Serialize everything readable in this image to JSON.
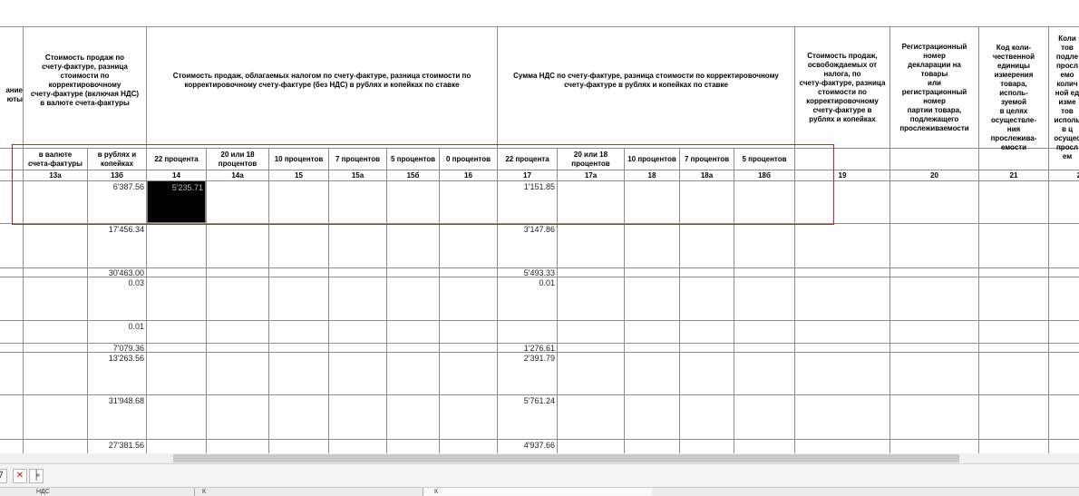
{
  "headers": {
    "c_left": "ание\nюты",
    "c13": "Стоимость продаж по\nсчету-фактуре, разница\nстоимости по\nкорректировочному\nсчету-фактуре (включая НДС)\nв валюте счета-фактуры",
    "c14group": "Стоимость продаж, облагаемых налогом по счету-фактуре, разница стоимости по\nкорректировочному счету-фактуре (без НДС) в рублях и копейках по ставке",
    "c17group": "Сумма НДС по счету-фактуре, разница стоимости по корректировочному\nсчету-фактуре в рублях и копейках по ставке",
    "c19": "Стоимость продаж,\nосвобождаемых от\nналога, по\nсчету-фактуре, разница\nстоимости по\nкорректировочному\nсчету-фактуре в\nрублях и копейках",
    "c20": "Регистрационный\nномер\nдекларации на\nтовары\nили\nрегистрационный\nномер\nпартии товара,\nподлежащего\nпрослеживаемости",
    "c21": "Код коли-\nчественной\nединицы\nизмерения\nтовара,\nисполь-\nзуемой\nв целях\nосуществле-\nния\nпрослежива-\nемости",
    "c22": "Коли\nтов\nподле\nпросл\nемо\nколич\nной ед\nизме\nтов\nисполь\nв ц\nосущес\nпросл\nем",
    "sub13a": "в валюте\nсчета-фактуры",
    "sub13b": "в рублях и\nкопейках",
    "sub14": "22 процента",
    "sub14a": "20 или 18\nпроцентов",
    "sub15": "10 процентов",
    "sub15a": "7 процентов",
    "sub15b": "5 процентов",
    "sub16": "0 процентов",
    "sub17": "22 процента",
    "sub17a": "20 или 18\nпроцентов",
    "sub18": "10 процентов",
    "sub18a": "7 процентов",
    "sub18b": "5 процентов"
  },
  "col_numbers": [
    "13а",
    "13б",
    "14",
    "14а",
    "15",
    "15а",
    "15б",
    "16",
    "17",
    "17а",
    "18",
    "18а",
    "18б",
    "19",
    "20",
    "21",
    "2"
  ],
  "rows": [
    {
      "c13b": "6'387.56",
      "c14": "5'235.71",
      "c17": "1'151.85"
    },
    {
      "c13b": "17'456.34",
      "c14": "",
      "c17": "3'147.86"
    },
    {
      "c13b": "30'463.00",
      "c14": "",
      "c17": "5'493.33"
    },
    {
      "c13b": "0.03",
      "c14": "",
      "c17": "0.01"
    },
    {
      "c13b": "0.01",
      "c14": "",
      "c17": ""
    },
    {
      "c13b": "7'079.36",
      "c14": "",
      "c17": "1'276.61"
    },
    {
      "c13b": "13'263.56",
      "c14": "",
      "c17": "2'391.79"
    },
    {
      "c13b": "31'948.68",
      "c14": "",
      "c17": "5'761.24"
    },
    {
      "c13b": "27'381.56",
      "c14": "",
      "c17": "4'937.66"
    }
  ],
  "tabs": [
    {
      "label": "НДС"
    },
    {
      "label": "К"
    },
    {
      "label": "К"
    }
  ],
  "colors": {
    "grid": "#8c8c8c",
    "highlight": "#e21b1b",
    "selection": "#000000"
  }
}
